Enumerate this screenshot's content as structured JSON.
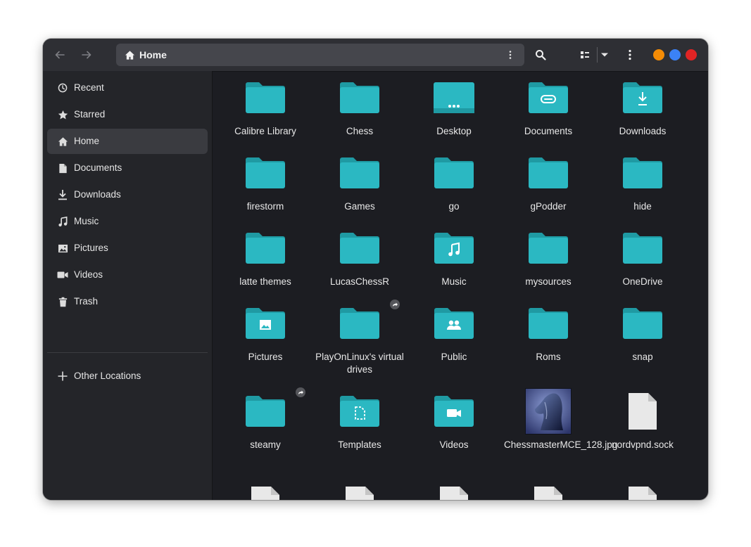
{
  "header": {
    "location_label": "Home"
  },
  "colors": {
    "folder": "#2bb8c2",
    "folder_dark": "#1f9aa3",
    "min_button": "#f48c06",
    "max_button": "#3b82f6",
    "close_button": "#e02424"
  },
  "sidebar": {
    "items": [
      {
        "label": "Recent",
        "icon": "clock-icon"
      },
      {
        "label": "Starred",
        "icon": "star-icon"
      },
      {
        "label": "Home",
        "icon": "home-icon"
      },
      {
        "label": "Documents",
        "icon": "document-icon"
      },
      {
        "label": "Downloads",
        "icon": "download-icon"
      },
      {
        "label": "Music",
        "icon": "music-icon"
      },
      {
        "label": "Pictures",
        "icon": "picture-icon"
      },
      {
        "label": "Videos",
        "icon": "video-icon"
      },
      {
        "label": "Trash",
        "icon": "trash-icon"
      }
    ],
    "other_locations": "Other Locations"
  },
  "files": [
    {
      "label": "Calibre Library",
      "type": "folder"
    },
    {
      "label": "Chess",
      "type": "folder"
    },
    {
      "label": "Desktop",
      "type": "desktop"
    },
    {
      "label": "Documents",
      "type": "folder-documents"
    },
    {
      "label": "Downloads",
      "type": "folder-downloads"
    },
    {
      "label": "firestorm",
      "type": "folder"
    },
    {
      "label": "Games",
      "type": "folder"
    },
    {
      "label": "go",
      "type": "folder"
    },
    {
      "label": "gPodder",
      "type": "folder"
    },
    {
      "label": "hide",
      "type": "folder"
    },
    {
      "label": "latte themes",
      "type": "folder"
    },
    {
      "label": "LucasChessR",
      "type": "folder"
    },
    {
      "label": "Music",
      "type": "folder-music"
    },
    {
      "label": "mysources",
      "type": "folder"
    },
    {
      "label": "OneDrive",
      "type": "folder"
    },
    {
      "label": "Pictures",
      "type": "folder-pictures"
    },
    {
      "label": "PlayOnLinux's virtual drives",
      "type": "folder-link"
    },
    {
      "label": "Public",
      "type": "folder-public"
    },
    {
      "label": "Roms",
      "type": "folder"
    },
    {
      "label": "snap",
      "type": "folder"
    },
    {
      "label": "steamy",
      "type": "folder-link"
    },
    {
      "label": "Templates",
      "type": "folder-templates"
    },
    {
      "label": "Videos",
      "type": "folder-videos"
    },
    {
      "label": "ChessmasterMCE_128.jpg",
      "type": "image"
    },
    {
      "label": "nordvpnd.sock",
      "type": "file"
    }
  ]
}
